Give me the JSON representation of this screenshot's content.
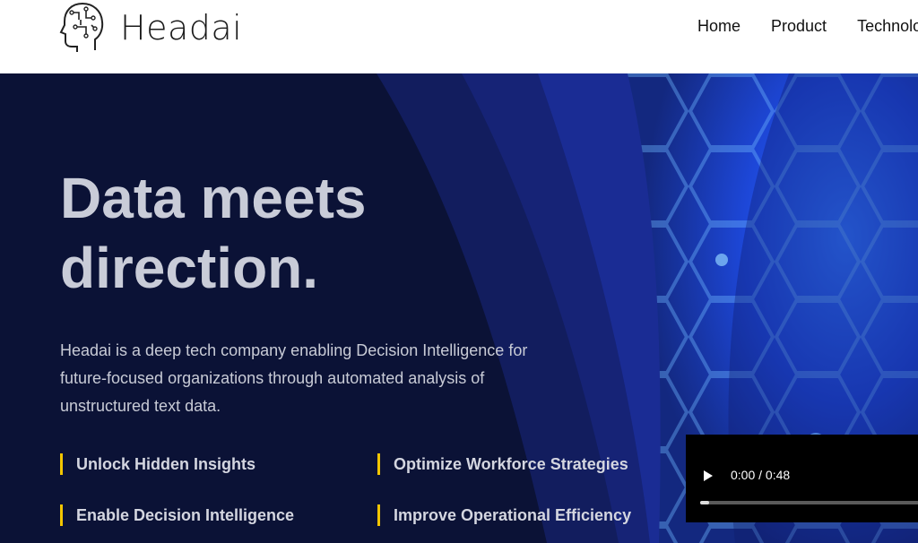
{
  "brand": {
    "name": "Headai",
    "logo_icon": "head-circuit-icon"
  },
  "nav": {
    "items": [
      "Home",
      "Product",
      "Technology"
    ]
  },
  "hero": {
    "headline_line1": "Data meets",
    "headline_line2": "direction.",
    "description": "Headai is a deep tech company enabling Decision Intelligence for future-focused organizations through automated analysis of unstructured text data.",
    "features": [
      "Unlock Hidden Insights",
      "Optimize Workforce Strategies",
      "Enable Decision Intelligence",
      "Improve Operational Efficiency"
    ]
  },
  "video": {
    "time": "0:00 / 0:48",
    "progress": 0.0,
    "play_icon": "play-icon"
  },
  "colors": {
    "navy": "#0b1236",
    "accent": "#f2c500",
    "blue": "#1b2fb0"
  }
}
